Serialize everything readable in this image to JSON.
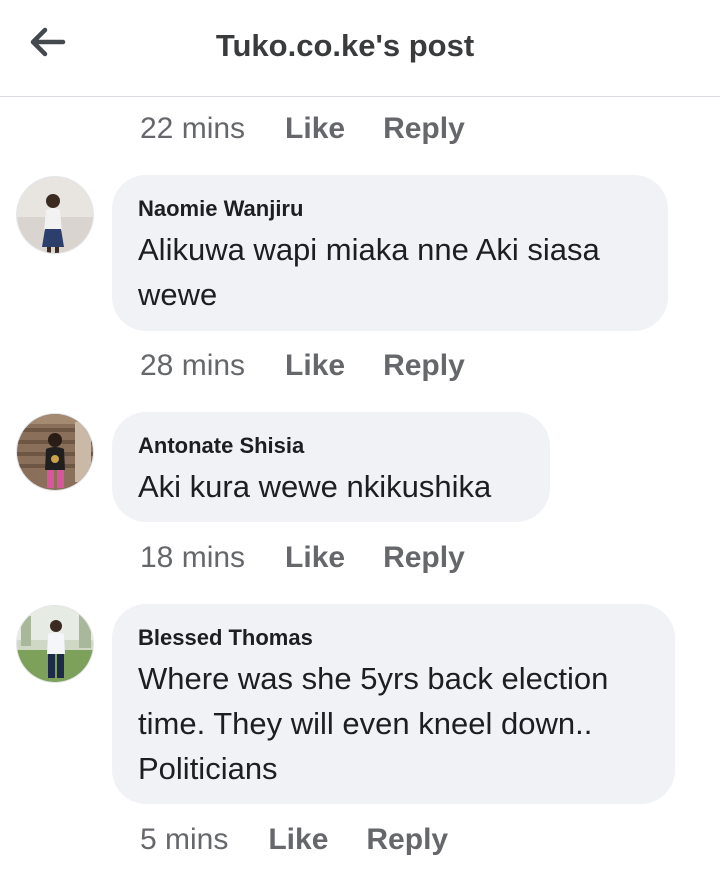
{
  "header": {
    "title": "Tuko.co.ke's post"
  },
  "top_actions": {
    "time": "22 mins",
    "like": "Like",
    "reply": "Reply"
  },
  "comments": [
    {
      "author": "Naomie Wanjiru",
      "text": "Alikuwa wapi miaka nne Aki siasa wewe",
      "time": "28 mins",
      "like": "Like",
      "reply": "Reply"
    },
    {
      "author": "Antonate Shisia",
      "text": "Aki kura wewe nkikushika",
      "time": "18 mins",
      "like": "Like",
      "reply": "Reply"
    },
    {
      "author": "Blessed Thomas",
      "text": "Where was she 5yrs back election time. They will even kneel down.. Politicians",
      "time": "5 mins",
      "like": "Like",
      "reply": "Reply"
    }
  ],
  "colors": {
    "bubble_bg": "#f0f2f5",
    "meta_text": "#65676b",
    "primary_text": "#1c1e21"
  }
}
